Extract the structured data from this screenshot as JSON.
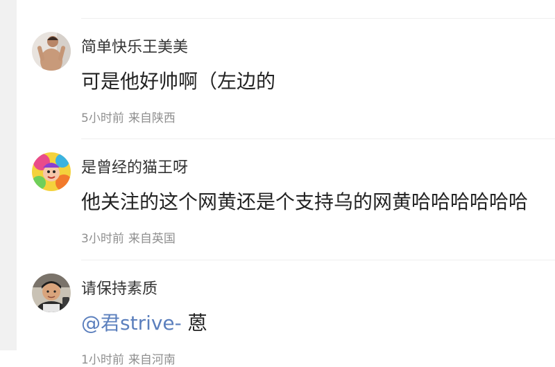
{
  "comments": [
    {
      "username": "简单快乐王美美",
      "text": "可是他好帅啊（左边的",
      "time": "5小时前",
      "location": "来自陕西"
    },
    {
      "username": "是曾经的猫王呀",
      "text": "他关注的这个网黄还是个支持乌的网黄哈哈哈哈哈哈",
      "time": "3小时前",
      "location": "来自英国"
    },
    {
      "username": "请保持素质",
      "mention": "@君strive-",
      "text": " 蒽",
      "time": "1小时前",
      "location": "来自河南"
    }
  ],
  "colors": {
    "mention": "#5b7fbd",
    "meta": "#8f8f8f",
    "divider": "#eeeeee",
    "sidebar": "#f1f1f1"
  },
  "icons": [
    "avatar-shirtless-man",
    "avatar-colorful-cartoon",
    "avatar-young-man"
  ]
}
